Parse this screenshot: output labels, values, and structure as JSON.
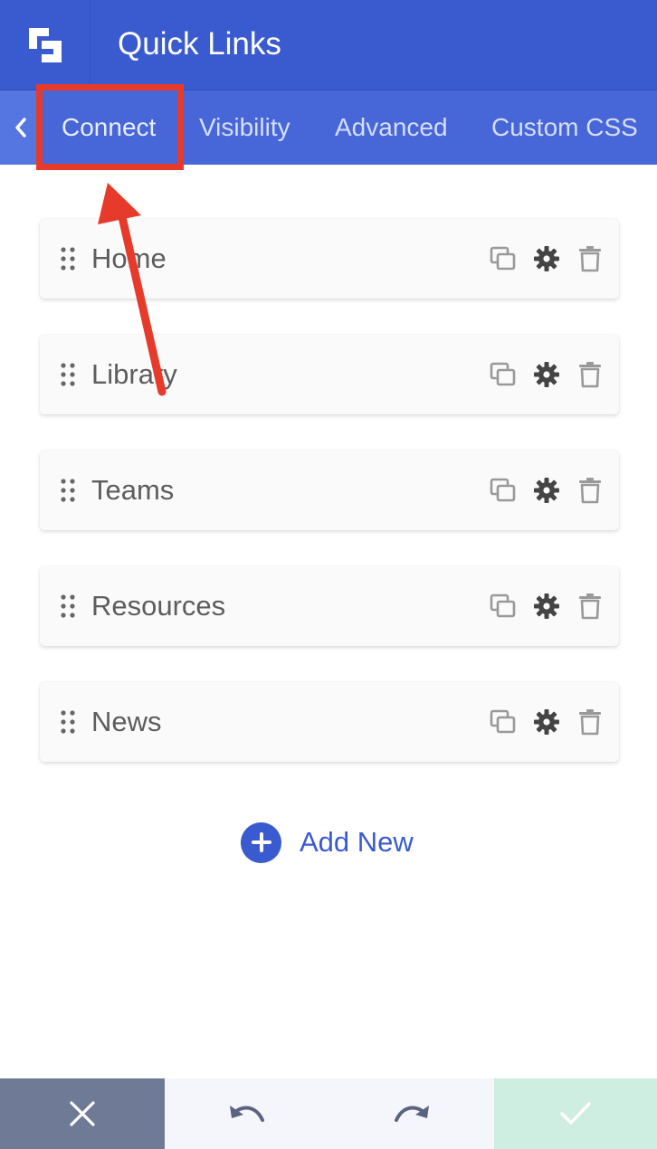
{
  "header": {
    "title": "Quick Links",
    "logo_icon": "builder-logo-icon"
  },
  "tabs": {
    "back_icon": "chevron-left-icon",
    "items": [
      {
        "label": "Connect",
        "active": true
      },
      {
        "label": "Visibility",
        "active": false
      },
      {
        "label": "Advanced",
        "active": false
      },
      {
        "label": "Custom CSS",
        "active": false
      }
    ]
  },
  "items": [
    {
      "label": "Home"
    },
    {
      "label": "Library"
    },
    {
      "label": "Teams"
    },
    {
      "label": "Resources"
    },
    {
      "label": "News"
    }
  ],
  "item_actions": [
    "copy-icon",
    "gear-icon",
    "trash-icon"
  ],
  "add_new": {
    "label": "Add New"
  },
  "footer": {
    "buttons": [
      "close-icon",
      "undo-icon",
      "redo-icon",
      "check-icon"
    ]
  },
  "colors": {
    "primary": "#3a5bd0",
    "tab_bar": "#4766d8",
    "annotation": "#e63b2a",
    "cancel_bg": "#6f7b96",
    "save_bg": "#cdeee0"
  }
}
